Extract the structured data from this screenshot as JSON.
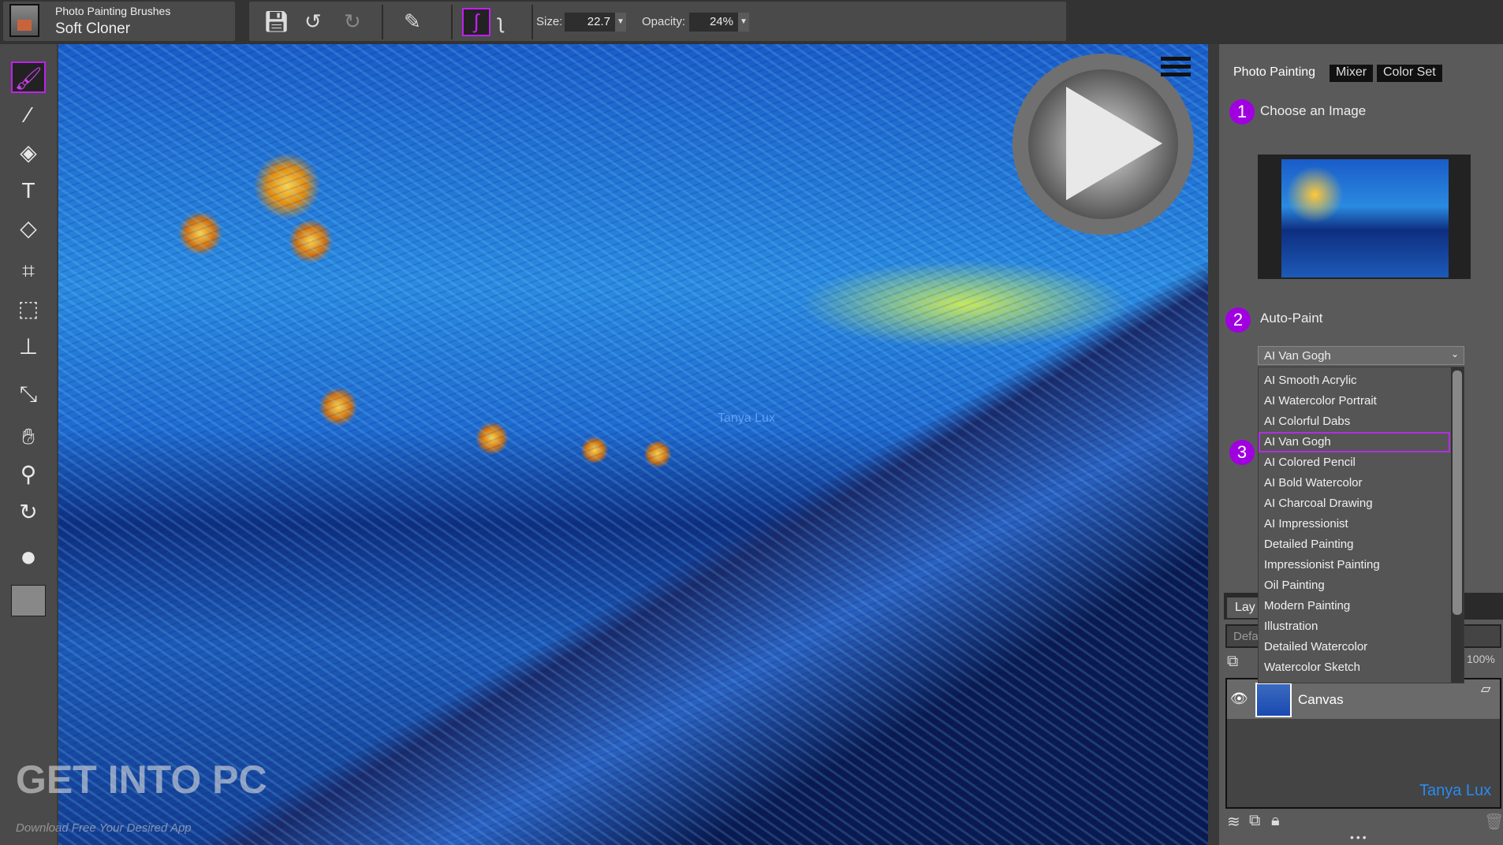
{
  "brush": {
    "category": "Photo Painting Brushes",
    "variant": "Soft Cloner"
  },
  "toolbar": {
    "size_label": "Size:",
    "size_value": "22.7",
    "opacity_label": "Opacity:",
    "opacity_value": "24%"
  },
  "canvas": {
    "signature": "Tanya Lux"
  },
  "watermark": {
    "title": "GET INTO PC",
    "subtitle": "Download Free Your Desired App"
  },
  "panel": {
    "tabs": [
      "Photo Painting",
      "Mixer",
      "Color Set"
    ],
    "step1": {
      "num": "1",
      "title": "Choose an Image"
    },
    "step2": {
      "num": "2",
      "title": "Auto-Paint"
    },
    "step3": {
      "num": "3"
    },
    "autopaint_selected": "AI Van Gogh",
    "options": [
      "AI Smooth Acrylic",
      "AI Watercolor Portrait",
      "AI Colorful Dabs",
      "AI Van Gogh",
      "AI Colored Pencil",
      "AI Bold Watercolor",
      "AI Charcoal Drawing",
      "AI Impressionist",
      "Detailed Painting",
      "Impressionist Painting",
      "Oil Painting",
      "Modern Painting",
      "Illustration",
      "Detailed Watercolor",
      "Watercolor Sketch"
    ]
  },
  "layers": {
    "tab": "Lay",
    "blend": "Defa",
    "opacity": "100%",
    "layer_name": "Canvas",
    "signature": "Tanya Lux"
  },
  "colors": {
    "accent": "#a000e0",
    "signature": "#2a8af0"
  }
}
